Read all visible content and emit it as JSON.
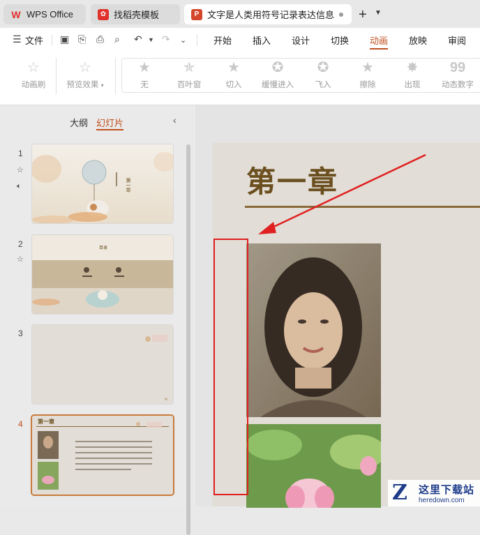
{
  "tabs": [
    {
      "label": "WPS Office",
      "icon": "wps-logo-icon"
    },
    {
      "label": "找稻壳模板",
      "icon": "daoke-icon"
    },
    {
      "label": "文字是人类用符号记录表达信息以",
      "icon": "presentation-icon"
    }
  ],
  "menu": {
    "file": "文件",
    "items": [
      "开始",
      "插入",
      "设计",
      "切换",
      "动画",
      "放映",
      "审阅"
    ],
    "active": "动画"
  },
  "ribbon": {
    "animation_brush": "动画刷",
    "preview": "预览效果",
    "effects": [
      "无",
      "百叶窗",
      "切入",
      "缓慢进入",
      "飞入",
      "擦除",
      "出现",
      "动态数字"
    ]
  },
  "panel": {
    "outline_tab": "大纲",
    "slides_tab": "幻灯片",
    "slides": [
      {
        "number": "1"
      },
      {
        "number": "2"
      },
      {
        "number": "3"
      },
      {
        "number": "4"
      }
    ],
    "thumb1_title": "第一章",
    "thumb2_title": "目录",
    "thumb4_title": "第一章"
  },
  "slide": {
    "title": "第一章"
  },
  "watermark": {
    "logo": "Z",
    "name": "这里下载站",
    "url": "heredown.com"
  },
  "colors": {
    "accent": "#c0501f",
    "title_brown": "#6b4f1f",
    "annotation_red": "#e02020"
  }
}
